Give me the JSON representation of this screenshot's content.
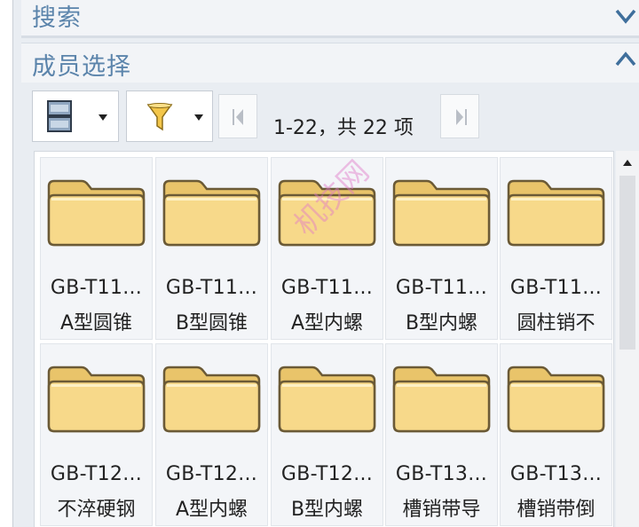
{
  "sections": {
    "search_title": "搜索",
    "members_title": "成员选择"
  },
  "toolbar": {
    "range_text": "1-22，共 22 项"
  },
  "watermark": "机技网",
  "tiles": [
    {
      "name": "GB-T11...",
      "desc": "A型圆锥"
    },
    {
      "name": "GB-T11...",
      "desc": "B型圆锥"
    },
    {
      "name": "GB-T11...",
      "desc": "A型内螺"
    },
    {
      "name": "GB-T11...",
      "desc": "B型内螺"
    },
    {
      "name": "GB-T11...",
      "desc": "圆柱销不"
    },
    {
      "name": "GB-T12...",
      "desc": "不淬硬钢"
    },
    {
      "name": "GB-T12...",
      "desc": "A型内螺"
    },
    {
      "name": "GB-T12...",
      "desc": "B型内螺"
    },
    {
      "name": "GB-T13...",
      "desc": "槽销带导"
    },
    {
      "name": "GB-T13...",
      "desc": "槽销带倒"
    }
  ],
  "colors": {
    "section_title": "#5b84ab",
    "folder_fill": "#f7d98a",
    "folder_stroke": "#6b5a36"
  },
  "icons": {
    "view_mode": "palette-view-icon",
    "filter": "funnel-filter-icon",
    "first_page": "first-page-icon",
    "last_page": "last-page-icon",
    "expand": "chevron-down-icon",
    "collapse": "chevron-up-icon",
    "folder": "folder-icon"
  }
}
